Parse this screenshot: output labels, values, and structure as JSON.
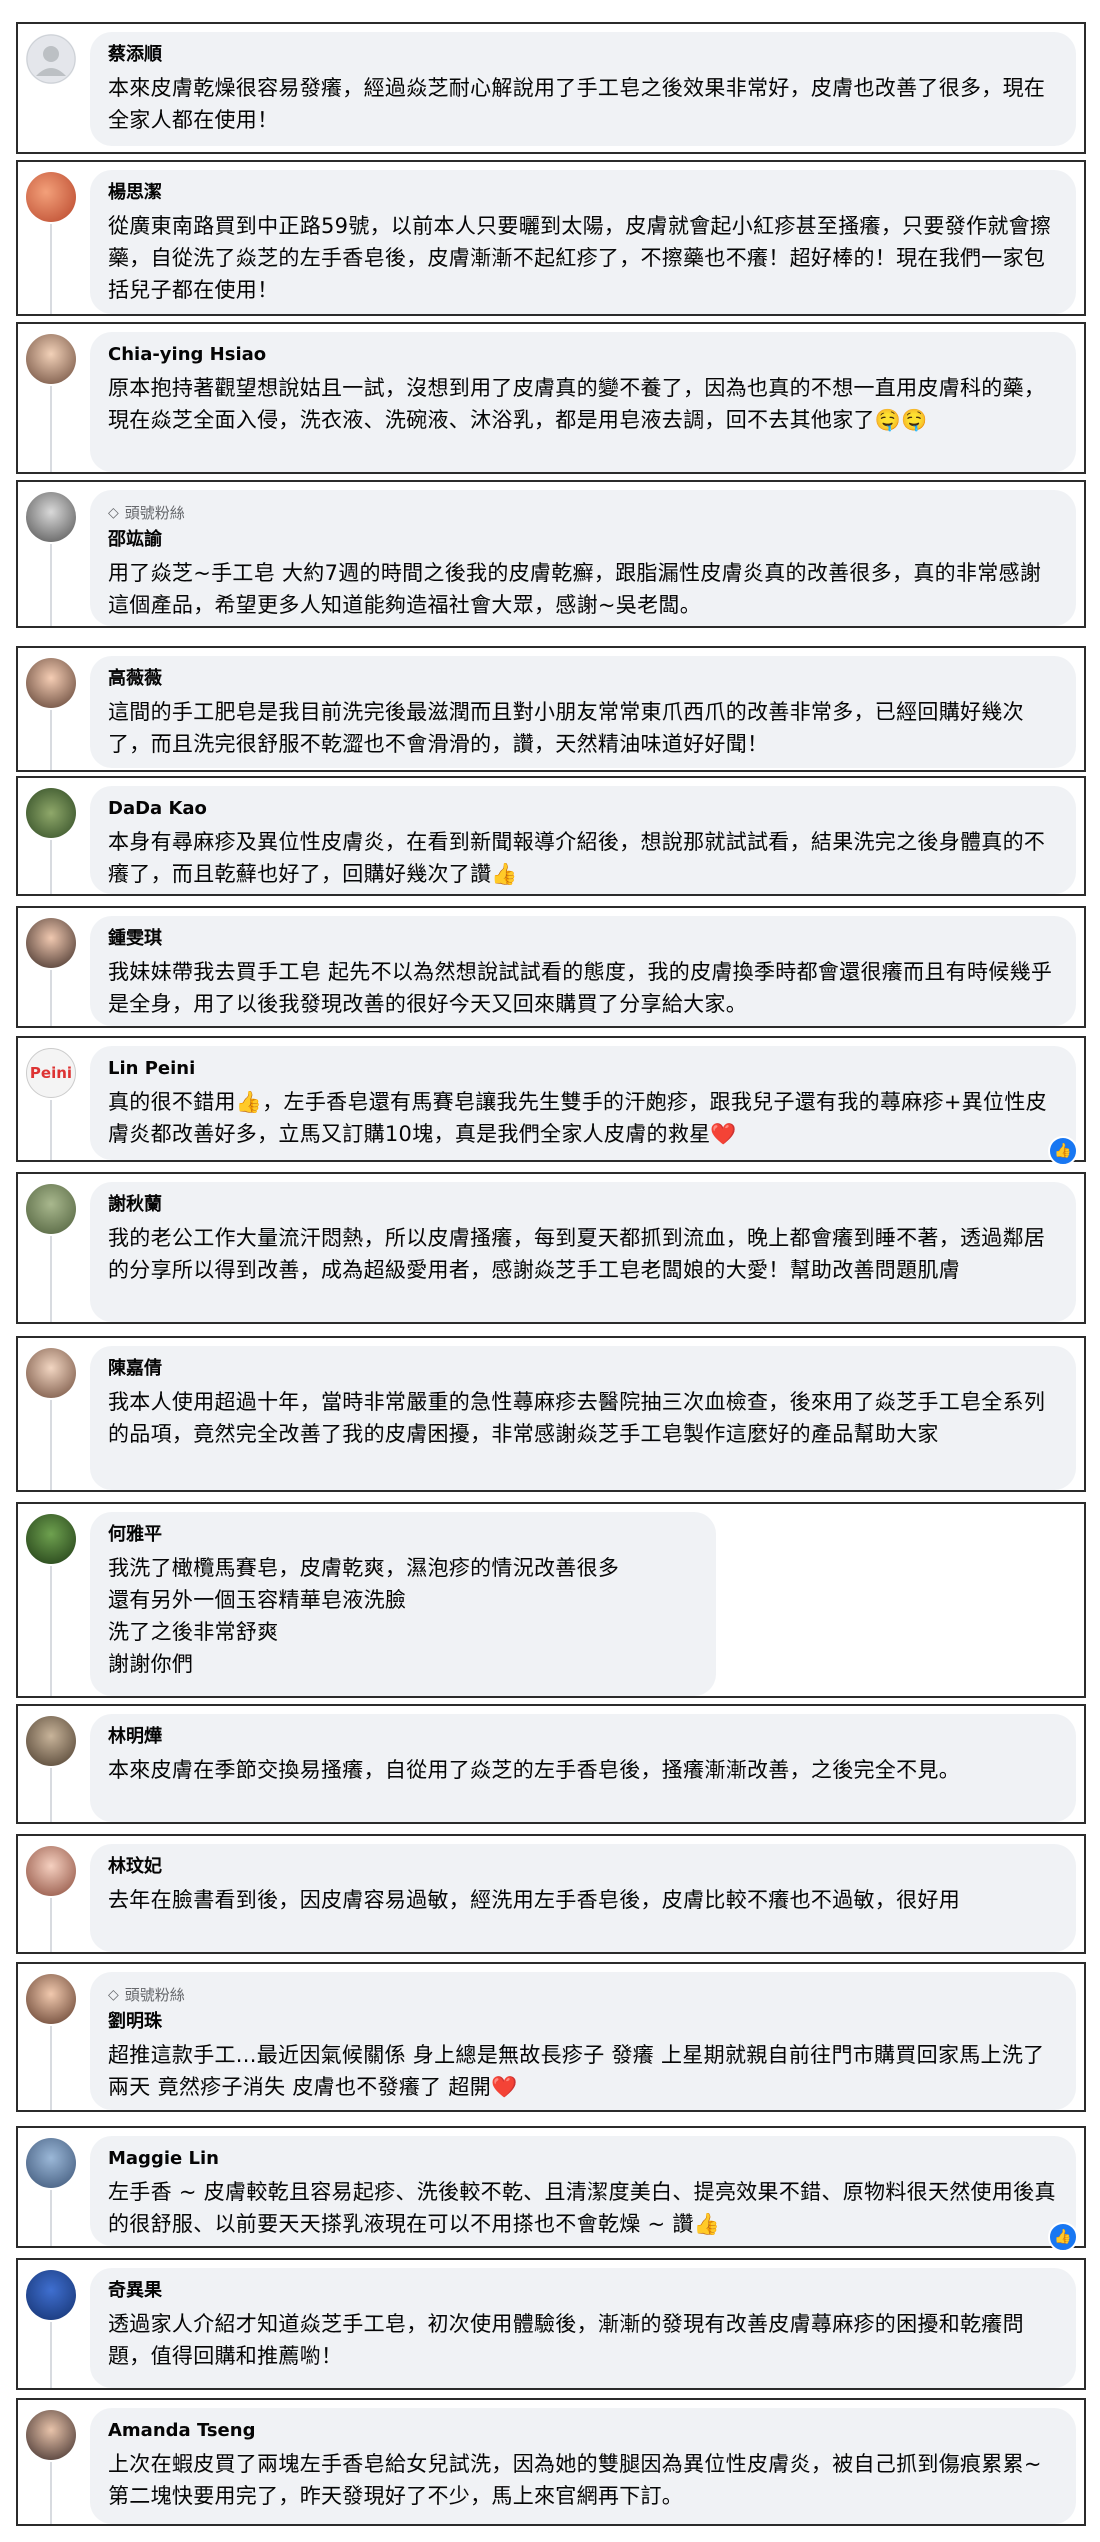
{
  "badge_label": "頭號粉絲",
  "reviews": [
    {
      "name": "蔡添順",
      "text": "本來皮膚乾燥很容易發癢，經過焱芝耐心解說用了手工皂之後效果非常好，皮膚也改善了很多，現在全家人都在使用！",
      "badge": false,
      "avatar": "default-avatar-icon"
    },
    {
      "name": "楊思潔",
      "text": "從廣東南路買到中正路59號，以前本人只要曬到太陽，皮膚就會起小紅疹甚至搔癢，只要發作就會擦藥，自從洗了焱芝的左手香皂後，皮膚漸漸不起紅疹了，不擦藥也不癢！超好棒的！現在我們一家包括兒子都在使用！",
      "badge": false,
      "avatar": "photo"
    },
    {
      "name": "Chia-ying Hsiao",
      "text": "原本抱持著觀望想說姑且一試，沒想到用了皮膚真的變不養了，因為也真的不想一直用皮膚科的藥，現在焱芝全面入侵，洗衣液、洗碗液、沐浴乳，都是用皂液去調，回不去其他家了🤤🤤",
      "badge": false,
      "avatar": "photo"
    },
    {
      "name": "邵竑諭",
      "text": "用了焱芝~手工皂 大約7週的時間之後我的皮膚乾癬，跟脂漏性皮膚炎真的改善很多，真的非常感謝這個產品，希望更多人知道能夠造福社會大眾，感謝~吳老闆。",
      "badge": true,
      "avatar": "photo"
    },
    {
      "name": "高薇薇",
      "text": "這間的手工肥皂是我目前洗完後最滋潤而且對小朋友常常東爪西爪的改善非常多，已經回購好幾次了，而且洗完很舒服不乾澀也不會滑滑的，讚，天然精油味道好好聞！",
      "badge": false,
      "avatar": "photo"
    },
    {
      "name": "DaDa Kao",
      "text": "本身有尋麻疹及異位性皮膚炎，在看到新聞報導介紹後，想說那就試試看，結果洗完之後身體真的不癢了，而且乾蘚也好了，回購好幾次了讚👍",
      "badge": false,
      "avatar": "photo"
    },
    {
      "name": "鍾雯琪",
      "text": "我妹妹帶我去買手工皂 起先不以為然想說試試看的態度，我的皮膚換季時都會還很癢而且有時候幾乎是全身，用了以後我發現改善的很好今天又回來購買了分享給大家。",
      "badge": false,
      "avatar": "photo"
    },
    {
      "name": "Lin Peini",
      "text": "真的很不錯用👍，左手香皂還有馬賽皂讓我先生雙手的汗皰疹，跟我兒子還有我的蕁麻疹+異位性皮膚炎都改善好多，立馬又訂購10塊，真是我們全家人皮膚的救星❤️",
      "badge": false,
      "avatar": "photo"
    },
    {
      "name": "謝秋蘭",
      "text": "我的老公工作大量流汗悶熱，所以皮膚搔癢，每到夏天都抓到流血，晚上都會癢到睡不著，透過鄰居的分享所以得到改善，成為超級愛用者，感謝焱芝手工皂老闆娘的大愛！幫助改善問題肌膚",
      "badge": false,
      "avatar": "photo"
    },
    {
      "name": "陳嘉倩",
      "text": "我本人使用超過十年，當時非常嚴重的急性蕁麻疹去醫院抽三次血檢查，後來用了焱芝手工皂全系列的品項，竟然完全改善了我的皮膚困擾，非常感謝焱芝手工皂製作這麼好的產品幫助大家",
      "badge": false,
      "avatar": "photo"
    },
    {
      "name": "何雅平",
      "text": "我洗了橄欖馬賽皂，皮膚乾爽，濕泡疹的情況改善很多\n還有另外一個玉容精華皂液洗臉\n洗了之後非常舒爽\n謝謝你們",
      "badge": false,
      "avatar": "photo"
    },
    {
      "name": "林明燁",
      "text": "本來皮膚在季節交換易搔癢，自從用了焱芝的左手香皂後，搔癢漸漸改善，之後完全不見。",
      "badge": false,
      "avatar": "photo"
    },
    {
      "name": "林玟妃",
      "text": "去年在臉書看到後，因皮膚容易過敏，經洗用左手香皂後，皮膚比較不癢也不過敏，很好用",
      "badge": false,
      "avatar": "photo"
    },
    {
      "name": "劉明珠",
      "text": "超推這款手工...最近因氣候關係 身上總是無故長疹子 發癢 上星期就親自前往門市購買回家馬上洗了兩天 竟然疹子消失 皮膚也不發癢了 超開❤️",
      "badge": true,
      "avatar": "photo"
    },
    {
      "name": "Maggie Lin",
      "text": "左手香 ~ 皮膚較乾且容易起疹、洗後較不乾、且清潔度美白、提亮效果不錯、原物料很天然使用後真的很舒服、以前要天天搽乳液現在可以不用搽也不會乾燥 ~ 讚👍",
      "badge": false,
      "avatar": "photo"
    },
    {
      "name": "奇異果",
      "text": "透過家人介紹才知道焱芝手工皂，初次使用體驗後，漸漸的發現有改善皮膚蕁麻疹的困擾和乾癢問題，值得回購和推薦喲！",
      "badge": false,
      "avatar": "photo"
    },
    {
      "name": "Amanda Tseng",
      "text": "上次在蝦皮買了兩塊左手香皂給女兒試洗，因為她的雙腿因為異位性皮膚炎，被自己抓到傷痕累累~第二塊快要用完了，昨天發現好了不少，馬上來官網再下訂。",
      "badge": false,
      "avatar": "photo"
    }
  ],
  "colors": {
    "bubble": "#f0f2f5",
    "border": "#2b2b2b",
    "reaction": "#1877f2"
  }
}
